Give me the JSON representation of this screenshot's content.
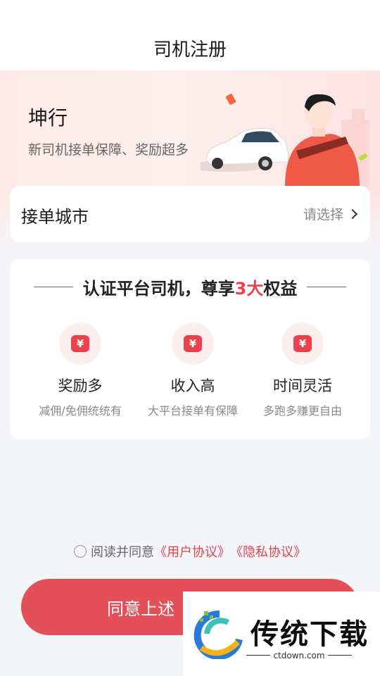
{
  "header": {
    "title": "司机注册"
  },
  "hero": {
    "brand": "坤行",
    "slogan": "新司机接单保障、奖励超多"
  },
  "city": {
    "label": "接单城市",
    "select_label": "请选择"
  },
  "benefits": {
    "heading_prefix": "认证平台司机，尊享",
    "heading_highlight": "3大",
    "heading_suffix": "权益",
    "items": [
      {
        "icon": "yuan-coupon-icon",
        "glyph": "¥",
        "name": "奖励多",
        "desc": "减佣/免佣统统有"
      },
      {
        "icon": "yuan-coupon-icon",
        "glyph": "¥",
        "name": "收入高",
        "desc": "大平台接单有保障"
      },
      {
        "icon": "yuan-coupon-icon",
        "glyph": "¥",
        "name": "时间灵活",
        "desc": "多跑多赚更自由"
      }
    ]
  },
  "agreement": {
    "prefix": "阅读并同意",
    "user_link": "《用户协议》",
    "privacy_link": "《隐私协议》"
  },
  "submit": {
    "label": "同意上述"
  },
  "watermark": {
    "name": "传统下载",
    "url": "ctdown.com"
  },
  "colors": {
    "accent": "#ef3f4c",
    "button": "#e4505a",
    "link": "#e3414d",
    "background": "#f4f5f9"
  }
}
